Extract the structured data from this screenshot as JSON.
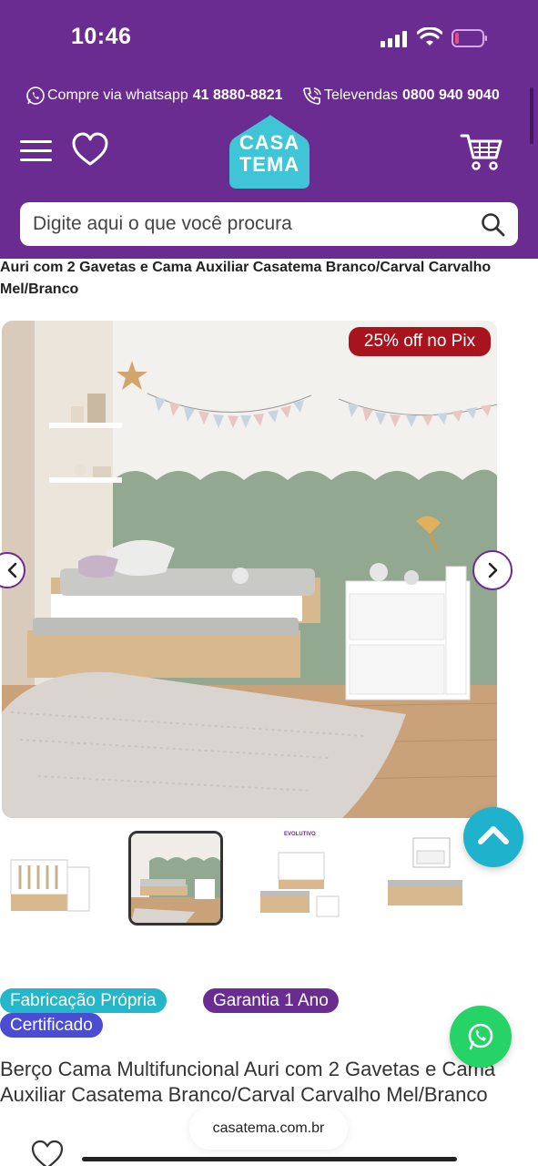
{
  "status_bar": {
    "time": "10:46"
  },
  "contact_bar": {
    "whatsapp_label": "Compre via whatsapp",
    "whatsapp_number": "41 8880-8821",
    "phone_label": "Televendas",
    "phone_number": "0800 940 9040"
  },
  "header": {
    "logo_line1": "CASA",
    "logo_line2": "TEMA",
    "icons": [
      "menu-icon",
      "heart-icon",
      "cart-icon"
    ]
  },
  "search": {
    "placeholder": "Digite aqui o que você procura"
  },
  "product": {
    "title_partial": "Auri com 2 Gavetas e Cama Auxiliar Casatema Branco/Carval Carvalho Mel/Branco",
    "discount_badge": "25% off no Pix",
    "badges": [
      "Fabricação Própria",
      "Garantia 1 Ano",
      "Certificado"
    ],
    "title": "Berço Cama Multifuncional Auri com 2 Gavetas e Cama Auxiliar Casatema Branco/Carval Carvalho Mel/Branco",
    "thumbnails": {
      "count": 4,
      "active_index": 1,
      "thumb3_caption": "EVOLUTIVO"
    }
  },
  "browser": {
    "url": "casatema.com.br"
  },
  "colors": {
    "brand_purple": "#6b2c91",
    "accent_teal": "#3fc5d6",
    "discount_red": "#a7141d",
    "badge_teal": "#24b6c9",
    "badge_purple": "#6b2c91",
    "badge_blue": "#4a4cd1",
    "whatsapp_green": "#25d366"
  }
}
